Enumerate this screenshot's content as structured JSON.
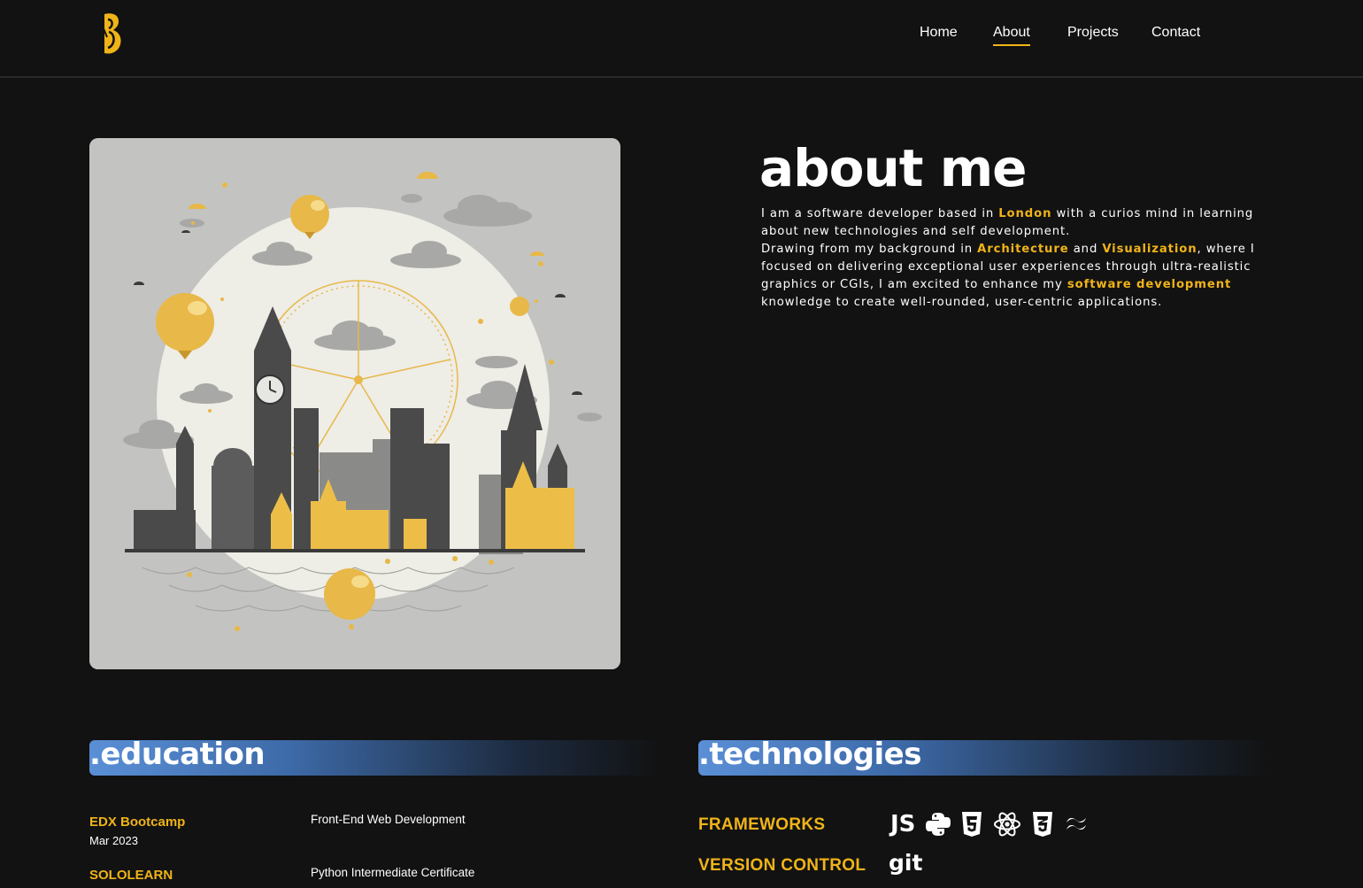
{
  "nav": {
    "items": [
      {
        "label": "Home",
        "active": false
      },
      {
        "label": "About",
        "active": true
      },
      {
        "label": "Projects",
        "active": false
      },
      {
        "label": "Contact",
        "active": false
      }
    ]
  },
  "about": {
    "title": "about me",
    "p1_a": "I am a software developer based in ",
    "p1_hl": "London",
    "p1_b": " with a curios mind in learning about new technologies and self development.",
    "p2_a": "Drawing from my background in ",
    "p2_hl1": "Architecture",
    "p2_b": " and ",
    "p2_hl2": "Visualization",
    "p2_c": ", where I focused on delivering exceptional user experiences through ultra-realistic graphics or CGIs, I am excited to enhance my ",
    "p2_hl3": "software development",
    "p2_d": " knowledge to create well-rounded, user-centric applications."
  },
  "education": {
    "title": ".education",
    "items": [
      {
        "name": "EDX Bootcamp",
        "date": "Mar 2023",
        "desc": "Front-End Web Development"
      },
      {
        "name": "SOLOLEARN",
        "date": "",
        "desc": "Python Intermediate Certificate"
      }
    ]
  },
  "technologies": {
    "title": ".technologies",
    "rows": [
      {
        "label": "FRAMEWORKS",
        "icons": [
          "javascript-icon",
          "python-icon",
          "html5-icon",
          "react-icon",
          "css3-icon",
          "tailwind-icon"
        ]
      },
      {
        "label": "VERSION CONTROL",
        "icons": [
          "git-icon"
        ]
      }
    ],
    "js_text": "JS",
    "git_text": "git"
  },
  "colors": {
    "accent": "#f0b418",
    "background": "#121212",
    "gradient_start": "#5a8fd6"
  }
}
